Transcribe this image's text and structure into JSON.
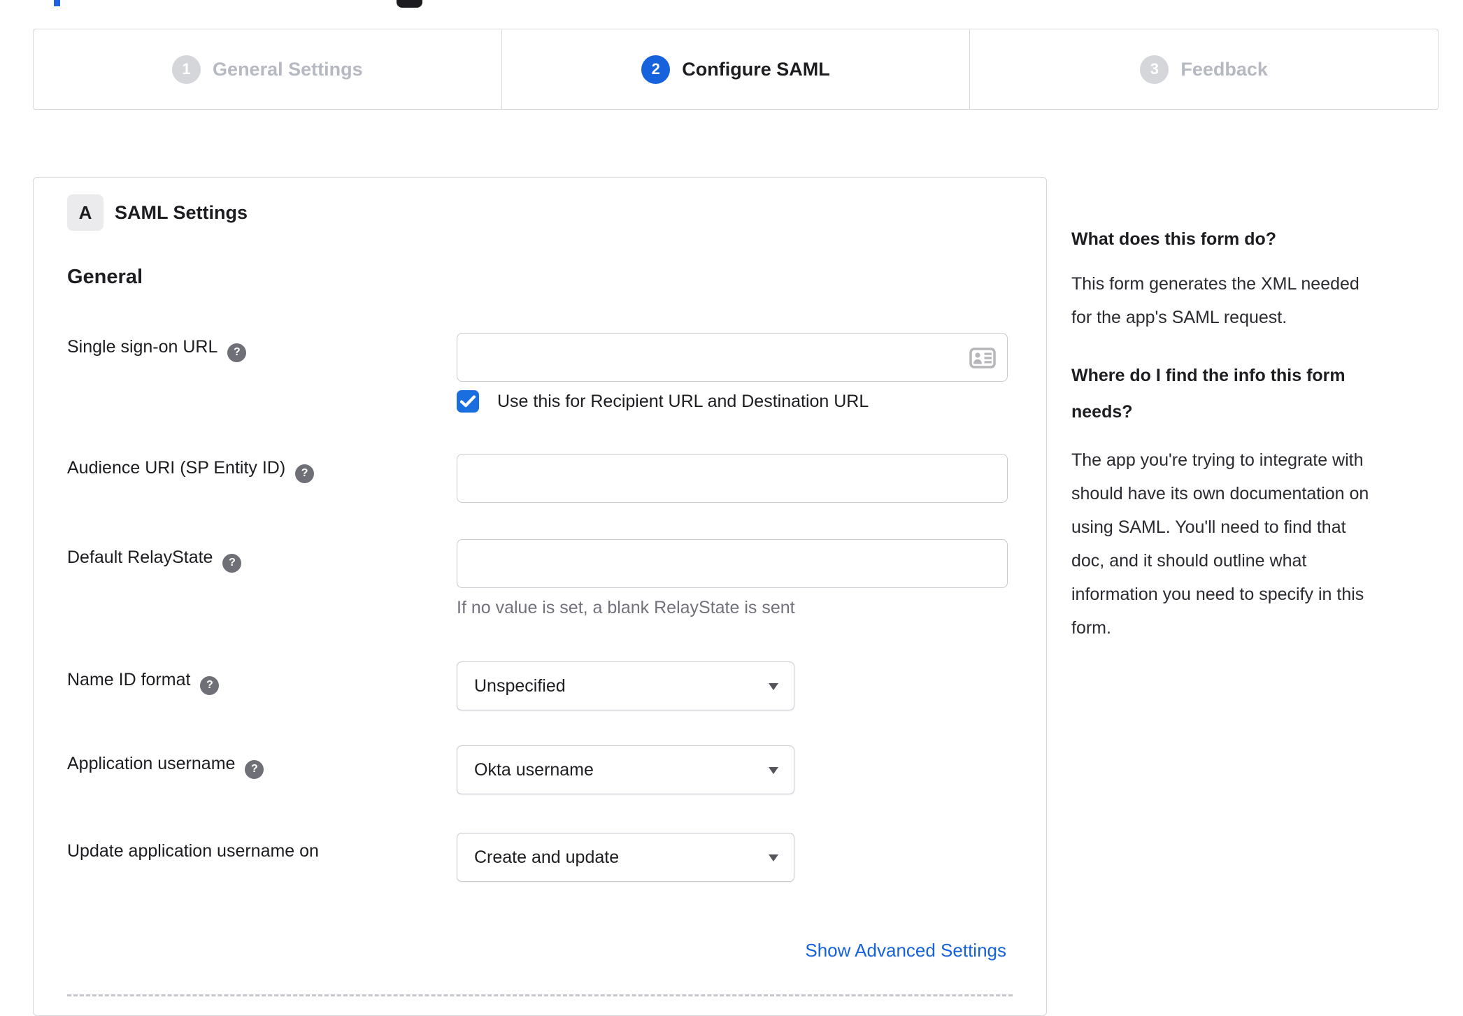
{
  "artifacts": {
    "blue_fragment_color": "#1f5fe0",
    "black_fragment_color": "#1b1b20"
  },
  "colors": {
    "accent_blue": "#1662dd",
    "checkbox_blue": "#1a6ee0",
    "link_blue": "#1662dd",
    "inactive_step_gray": "#b6b9c1",
    "step_circle_gray": "#d5d6da",
    "text_dark": "#1d1d21",
    "muted_gray": "#72727c",
    "panel_border": "#d8d8dc",
    "input_border": "#c9c9d0",
    "icon_gray": "#b5b5ba"
  },
  "stepper": {
    "steps": [
      {
        "number": "1",
        "label": "General Settings",
        "state": "inactive"
      },
      {
        "number": "2",
        "label": "Configure SAML",
        "state": "active"
      },
      {
        "number": "3",
        "label": "Feedback",
        "state": "inactive"
      }
    ]
  },
  "panel": {
    "badge": "A",
    "title": "SAML Settings",
    "section_heading": "General",
    "fields": [
      {
        "label": "Single sign-on URL",
        "value": "",
        "has_help": true
      },
      {
        "label": "Audience URI (SP Entity ID)",
        "value": "",
        "has_help": true
      },
      {
        "label": "Default RelayState",
        "value": "",
        "has_help": true,
        "note": "If no value is set, a blank RelayState is sent"
      },
      {
        "label": "Name ID format",
        "value": "Unspecified",
        "has_help": true
      },
      {
        "label": "Application username",
        "value": "Okta username",
        "has_help": true
      },
      {
        "label": "Update application username on",
        "value": "Create and update",
        "has_help": false
      }
    ],
    "checkbox": {
      "label": "Use this for Recipient URL and Destination URL",
      "checked": true
    },
    "advanced_link": "Show Advanced Settings"
  },
  "icons": {
    "help_glyph": "?"
  },
  "sidebar": {
    "sections": [
      {
        "heading": "What does this form do?",
        "body": "This form generates the XML needed\nfor the app's SAML request."
      },
      {
        "heading": "Where do I find the info this form\nneeds?",
        "body": "The app you're trying to integrate with\nshould have its own documentation on\nusing SAML. You'll need to find that\ndoc, and it should outline what\ninformation you need to specify in this\nform."
      }
    ]
  }
}
